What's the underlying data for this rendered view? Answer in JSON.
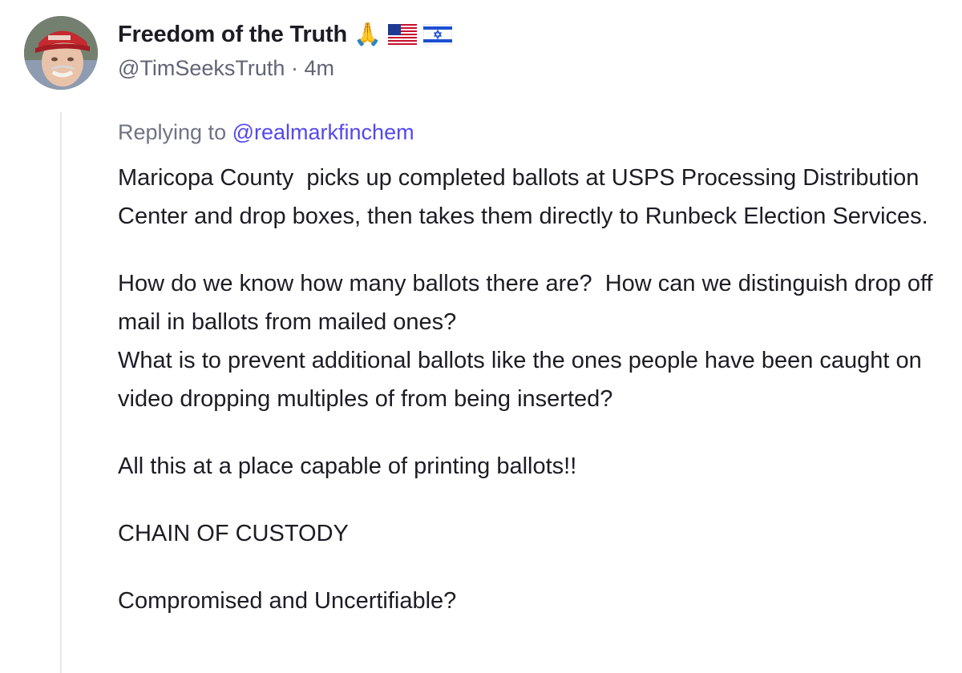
{
  "author": {
    "display_name": "Freedom of the Truth",
    "emojis": [
      "folded-hands",
      "us-flag",
      "israel-flag"
    ],
    "handle": "@TimSeeksTruth",
    "separator": "·",
    "time": "4m"
  },
  "reply": {
    "prefix": "Replying to",
    "mention": "@realmarkfinchem"
  },
  "body": {
    "p1": "Maricopa County  picks up completed ballots at USPS Processing Distribution Center and drop boxes, then takes them directly to Runbeck Election Services.",
    "p2": "How do we know how many ballots there are?  How can we distinguish drop off mail in ballots from mailed ones?\nWhat is to prevent additional ballots like the ones people have been caught on video dropping multiples of from being inserted?",
    "p3": "All this at a place capable of printing ballots!!",
    "p4": "CHAIN OF CUSTODY",
    "p5": "Compromised and Uncertifiable?"
  },
  "colors": {
    "text": "#1c1d24",
    "muted": "#606576",
    "mention": "#5448ee",
    "thread_line": "#e6e7ec"
  }
}
